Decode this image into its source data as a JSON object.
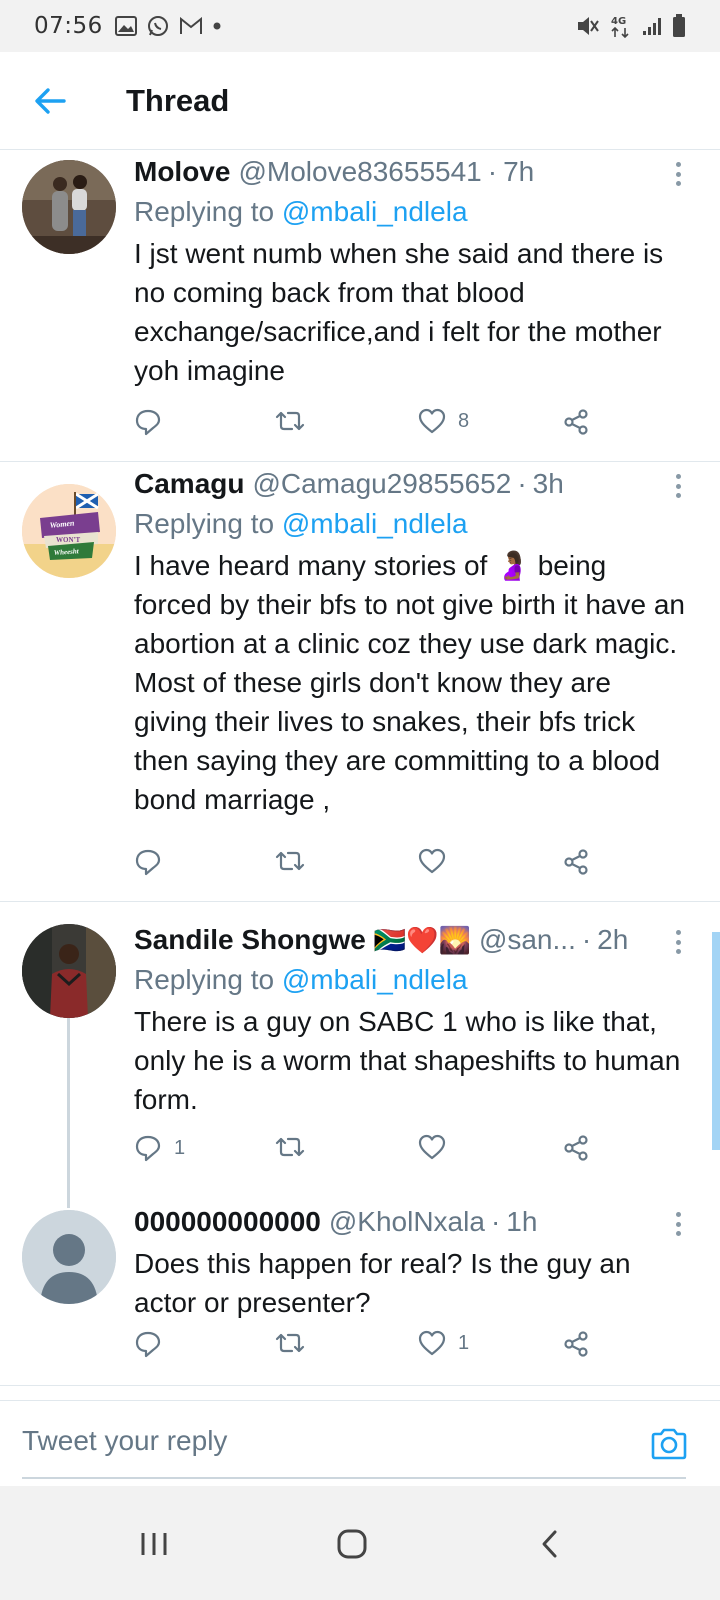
{
  "status_bar": {
    "time": "07:56",
    "network": "4G"
  },
  "header": {
    "title": "Thread"
  },
  "tweets": [
    {
      "name": "Molove",
      "handle": "@Molove83655541",
      "time": "7h",
      "replying_label": "Replying to",
      "replying_to": "@mbali_ndlela",
      "text": "I jst went numb when she said and there is no coming back from that blood exchange/sacrifice,and i felt for the mother yoh imagine",
      "reply_count": "",
      "retweet_count": "",
      "like_count": "8"
    },
    {
      "name": "Camagu",
      "handle": "@Camagu29855652",
      "time": "3h",
      "replying_label": "Replying to",
      "replying_to": "@mbali_ndlela",
      "text_before": "I have heard many stories of ",
      "text_after": " being forced by their bfs to not give birth it have an abortion at a clinic coz they use dark magic. Most of these girls don't know they are giving their lives to snakes, their bfs trick then saying they are committing to a blood bond marriage ,",
      "emoji": "🤰🏾",
      "avatar_sign": [
        "Women",
        "WON'T",
        "Wheesht"
      ],
      "reply_count": "",
      "retweet_count": "",
      "like_count": ""
    },
    {
      "name": "Sandile Shongwe",
      "emojis": "🇿🇦❤️🌄",
      "handle": "@san...",
      "time": "2h",
      "replying_label": "Replying to",
      "replying_to": "@mbali_ndlela",
      "text": "There is a guy on SABC 1 who is like that, only he is a worm that shapeshifts to human form.",
      "reply_count": "1",
      "retweet_count": "",
      "like_count": ""
    },
    {
      "name": "000000000000",
      "handle": "@KholNxala",
      "time": "1h",
      "text": "Does this happen for real? Is the guy an actor or presenter?",
      "reply_count": "",
      "retweet_count": "",
      "like_count": "1"
    }
  ],
  "reply_bar": {
    "placeholder": "Tweet your reply"
  },
  "colors": {
    "accent": "#1da1f2",
    "text": "#14171a",
    "muted": "#657786",
    "divider": "#e1e8ed"
  }
}
